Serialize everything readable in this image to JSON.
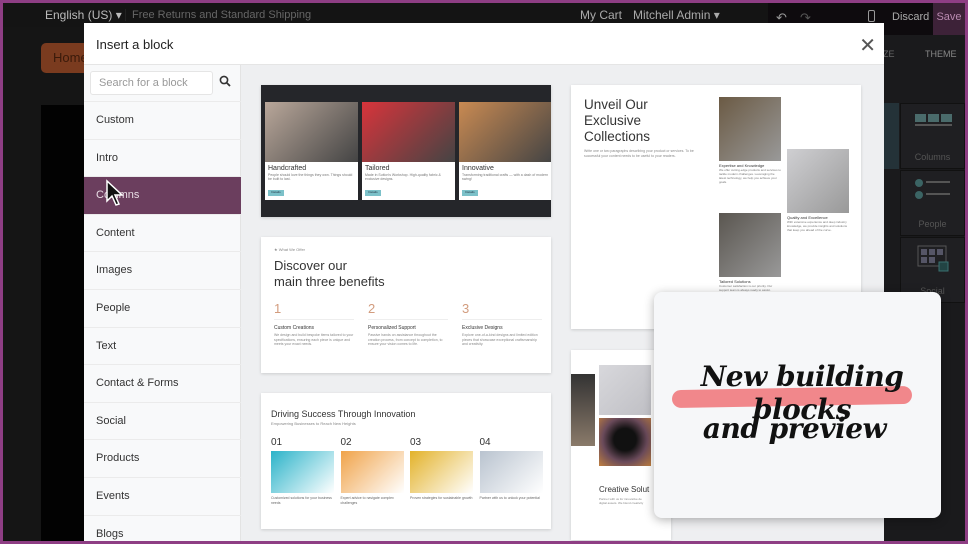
{
  "topbar": {
    "language": "English (US) ▾",
    "shipping": "Free Returns and Standard Shipping",
    "cart": "My Cart",
    "user": "Mitchell Admin ▾"
  },
  "editor": {
    "undo_icon": "↶",
    "redo_icon": "↷",
    "discard": "Discard",
    "save": "Save"
  },
  "site": {
    "home_button": "Home"
  },
  "right_panel": {
    "tabs": [
      "ZE",
      "THEME"
    ],
    "blocks": [
      "Columns",
      "People",
      "Social"
    ]
  },
  "modal": {
    "title": "Insert a block",
    "close": "✕",
    "search_placeholder": "Search for a block",
    "categories": [
      "Custom",
      "Intro",
      "Columns",
      "Content",
      "Images",
      "People",
      "Text",
      "Contact & Forms",
      "Social",
      "Products",
      "Events",
      "Blogs"
    ],
    "active_category": "Columns"
  },
  "previews": {
    "cards_block": {
      "items": [
        {
          "title": "Handcrafted",
          "desc": "People should love the things they own. Things should be built to last.",
          "button": "Details",
          "color": "#b9a79a"
        },
        {
          "title": "Tailored",
          "desc": "Made in Sutton's Workshop. High-quality fabric & exclusive designs.",
          "button": "Details",
          "color": "#d8343b"
        },
        {
          "title": "Innovative",
          "desc": "Transforming traditional crafts — with a dash of modern swing!",
          "button": "Details",
          "color": "#c98a52"
        }
      ]
    },
    "benefits_block": {
      "eyebrow": "★ What We Offer",
      "title_line1": "Discover our",
      "title_line2": "main three benefits",
      "items": [
        {
          "num": "1",
          "title": "Custom Creations",
          "desc": "We design and build bespoke items tailored to your specifications, ensuring each piece is unique and meets your exact needs."
        },
        {
          "num": "2",
          "title": "Personalized Support",
          "desc": "Passive hands on assistance throughout the creation process, from concept to completion, to ensure your vision comes to life."
        },
        {
          "num": "3",
          "title": "Exclusive Designs",
          "desc": "Explore one-of-a-kind designs and limited edition pieces that showcase exceptional craftsmanship and creativity."
        }
      ]
    },
    "steps_block": {
      "title": "Driving Success Through Innovation",
      "subtitle": "Empowering Businesses to Reach New Heights",
      "items": [
        {
          "num": "01",
          "desc": "Customized solutions for your business needs",
          "color": "#2bb3c9"
        },
        {
          "num": "02",
          "desc": "Expert advice to navigate complex challenges",
          "color": "#f0a34a"
        },
        {
          "num": "03",
          "desc": "Proven strategies for sustainable growth",
          "color": "#e3b22a"
        },
        {
          "num": "04",
          "desc": "Partner with us to unlock your potential",
          "color": "#b9c3cf"
        }
      ]
    },
    "collections_block": {
      "title_line1": "Unveil Our",
      "title_line2": "Exclusive",
      "title_line3": "Collections",
      "desc": "Write one or two paragraphs describing your product or services. To be successful your content needs to be useful to your readers.",
      "items": [
        {
          "title": "Expertise and Knowledge",
          "desc": "We offer cutting-edge products and services to tackle modern challenges. Leveraging the latest technology, we help you achieve your goals.",
          "color": "#6b5a44"
        },
        {
          "title": "Quality and Excellence",
          "desc": "With extensive experience and deep industry knowledge, we provide insights and solutions that keep you ahead of the curve.",
          "color": "#cfcfd2"
        },
        {
          "title": "Tailored Solutions",
          "desc": "Customer satisfaction is our priority. Our support team is always ready to assist.",
          "color": "#5a5650"
        }
      ]
    },
    "creative_block": {
      "title": "Creative Solut",
      "desc_line1": "Partner with us for innovative de",
      "desc_line2": "digital assets. We blend creativity"
    }
  },
  "overlay": {
    "line1": "New building blocks",
    "line2": "and preview",
    "highlight_color": "#f17a7e"
  }
}
